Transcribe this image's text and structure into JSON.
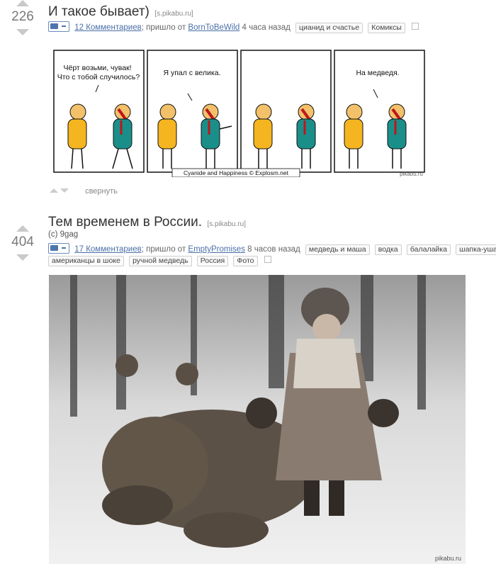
{
  "post1": {
    "score": "226",
    "title": "И такое бывает)",
    "domain": "[s.pikabu.ru]",
    "comments": "12 Комментариев",
    "came_from": "; пришло от",
    "author": "BornToBeWild",
    "time": "4 часа назад",
    "tags": [
      "цианид и счастье",
      "Комиксы"
    ],
    "comic": {
      "bubble1": [
        "Чёрт возьми, чувак!",
        "Что с тобой случилось?"
      ],
      "bubble2": "Я упал с велика.",
      "bubble4": "На медведя.",
      "credit": "Cyanide and Happiness © Explosm.net",
      "watermark": "pikabu.ru"
    },
    "collapse_label": "свернуть"
  },
  "post2": {
    "score": "404",
    "title": "Тем временем в России.",
    "domain": "[s.pikabu.ru]",
    "subtitle": "(c) 9gag",
    "comments": "17 Комментариев",
    "came_from": "; пришло от",
    "author": "EmptyPromises",
    "time": "8 часов назад",
    "tags_row1": [
      "медведь и маша",
      "водка",
      "балалайка",
      "шапка-ушанка"
    ],
    "tags_row2": [
      "американцы в шоке",
      "ручной медведь",
      "Россия",
      "Фото"
    ],
    "watermark": "pikabu.ru"
  },
  "colors": {
    "link": "#4b6fa8",
    "yellow_shirt": "#f5b520",
    "teal_shirt": "#1a8f8a",
    "blood": "#c0161a"
  },
  "icons": [
    "vote-up-icon",
    "vote-down-icon",
    "camera-icon",
    "save-icon"
  ]
}
